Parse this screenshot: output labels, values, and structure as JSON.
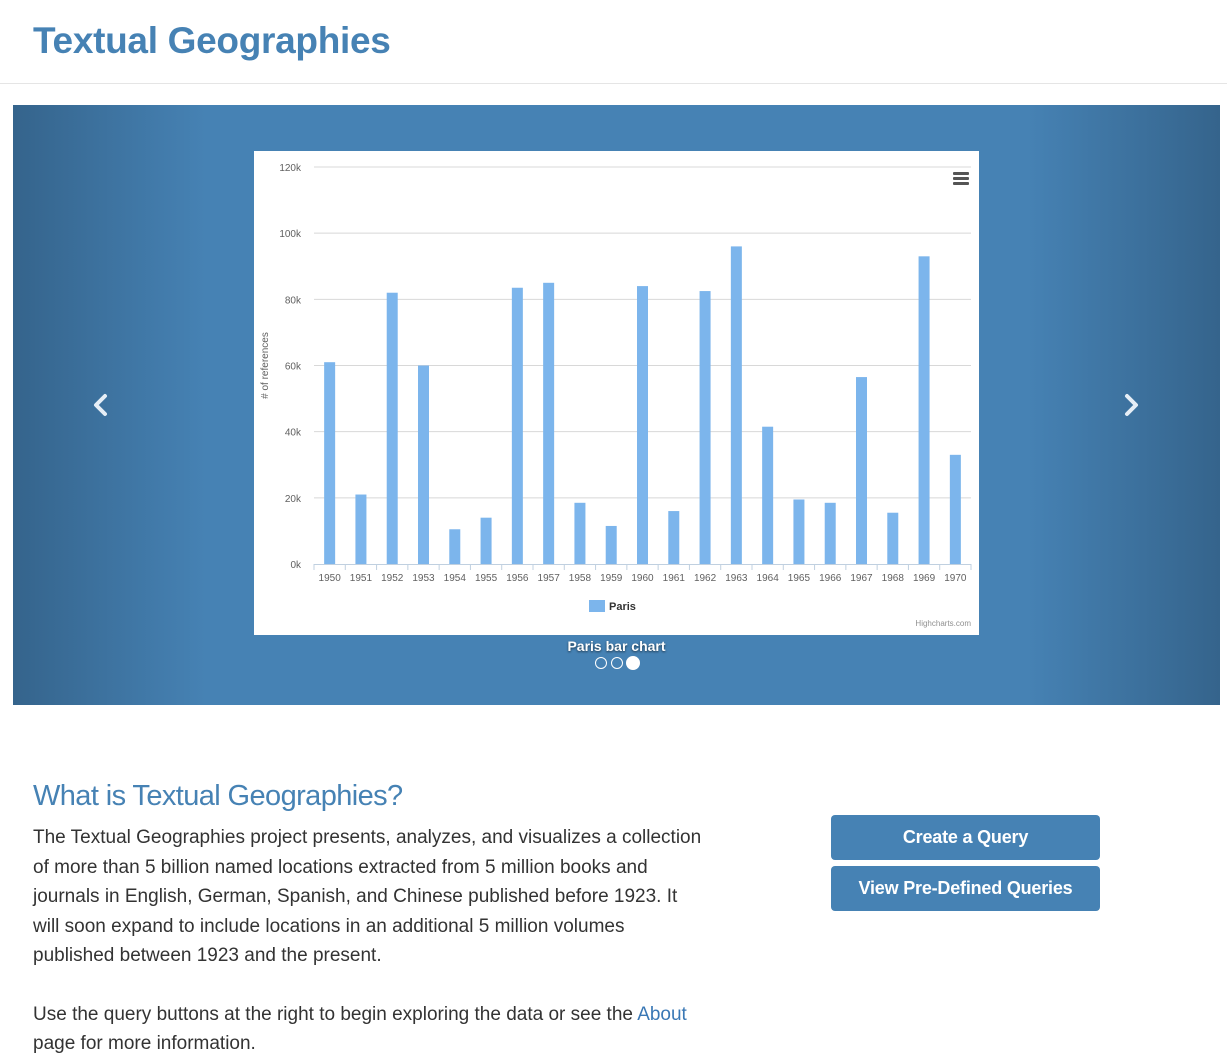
{
  "site": {
    "title": "Textual Geographies"
  },
  "carousel": {
    "caption": "Paris bar chart",
    "slide_count": 3,
    "active_slide": 3,
    "prev_icon": "chevron-left-icon",
    "next_icon": "chevron-right-icon"
  },
  "chart_data": {
    "type": "bar",
    "title": "",
    "ylabel": "# of references",
    "xlabel": "",
    "ylim": [
      0,
      120000
    ],
    "yticks": [
      "0k",
      "20k",
      "40k",
      "60k",
      "80k",
      "100k",
      "120k"
    ],
    "categories": [
      "1950",
      "1951",
      "1952",
      "1953",
      "1954",
      "1955",
      "1956",
      "1957",
      "1958",
      "1959",
      "1960",
      "1961",
      "1962",
      "1963",
      "1964",
      "1965",
      "1966",
      "1967",
      "1968",
      "1969",
      "1970"
    ],
    "series": [
      {
        "name": "Paris",
        "color": "#7cb5ec",
        "values": [
          61000,
          21000,
          82000,
          60000,
          10500,
          14000,
          83500,
          85000,
          18500,
          11500,
          84000,
          16000,
          82500,
          96000,
          41500,
          19500,
          18500,
          56500,
          15500,
          93000,
          33000
        ]
      }
    ],
    "legend_position": "bottom-center",
    "grid": true,
    "credits": "Highcharts.com",
    "menu_icon": "hamburger-menu-icon"
  },
  "about": {
    "heading": "What is Textual Geographies?",
    "paragraph1": "The Textual Geographies project presents, analyzes, and visualizes a collection of more than 5 billion named locations extracted from 5 million books and journals in English, German, Spanish, and Chinese published before 1923. It will soon expand to include locations in an additional 5 million volumes published between 1923 and the present.",
    "paragraph2_before": "Use the query buttons at the right to begin exploring the data or see the ",
    "about_link": "About",
    "paragraph2_after": " page for more information."
  },
  "buttons": {
    "create_query": "Create a Query",
    "view_predefined": "View Pre-Defined Queries"
  },
  "colors": {
    "accent": "#4682b4",
    "bar": "#7cb5ec"
  }
}
